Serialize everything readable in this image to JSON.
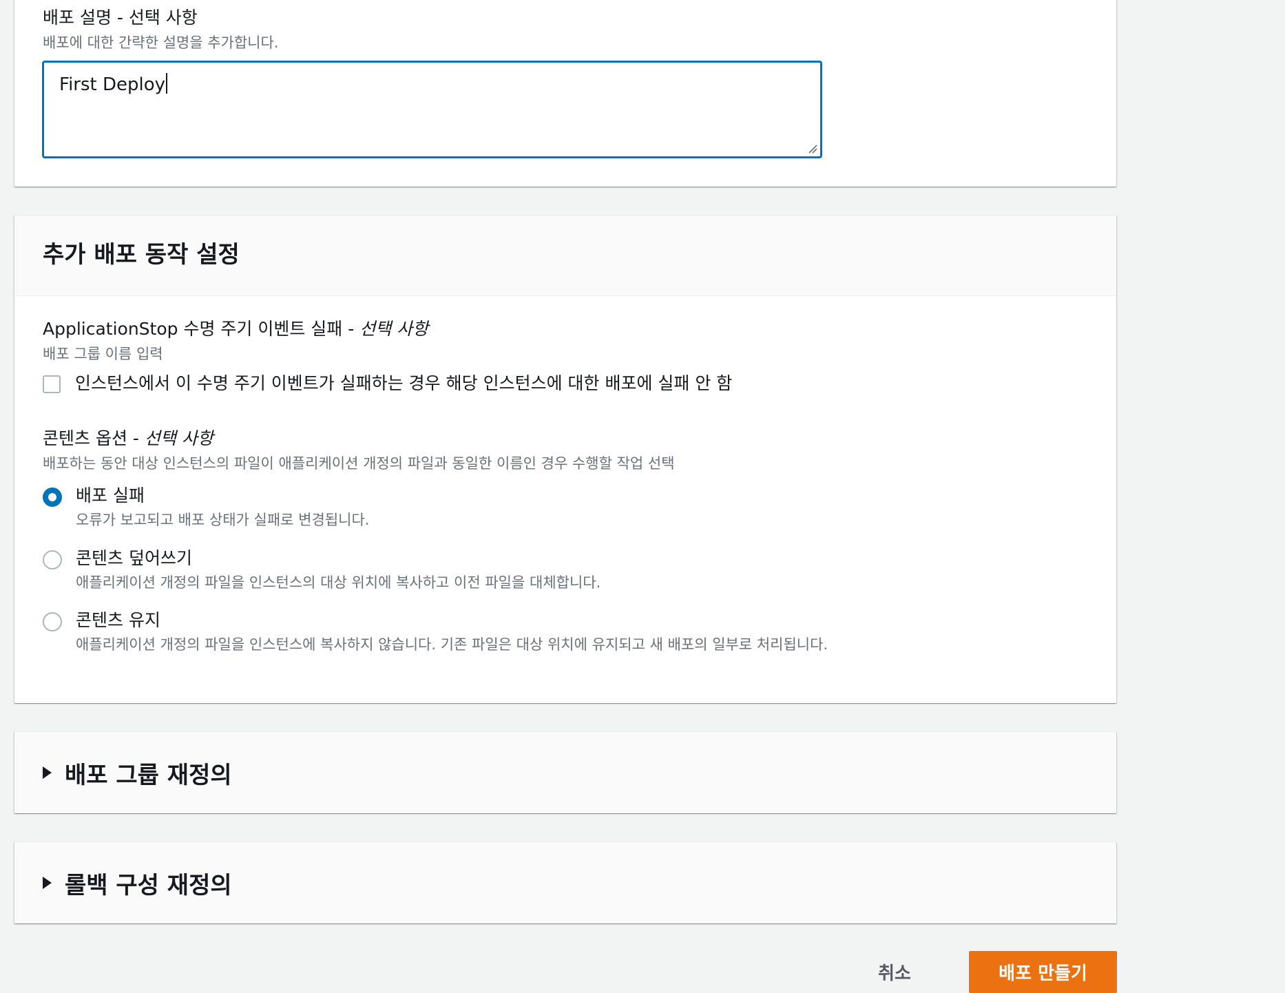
{
  "colors": {
    "accent": "#0073bb",
    "primary_button": "#ec7211",
    "page_background": "#f2f3f3",
    "secondary_text": "#687078"
  },
  "description_section": {
    "label": "배포 설명 - 선택 사항",
    "hint": "배포에 대한 간략한 설명을 추가합니다.",
    "textarea_value": "First Deploy"
  },
  "additional_settings": {
    "title": "추가 배포 동작 설정",
    "app_stop": {
      "label_main": "ApplicationStop 수명 주기 이벤트 실패 - ",
      "label_optional": "선택 사항",
      "hint": "배포 그룹 이름 입력",
      "checkbox_label": "인스턴스에서 이 수명 주기 이벤트가 실패하는 경우 해당 인스턴스에 대한 배포에 실패 안 함",
      "checkbox_checked": false
    },
    "content_options": {
      "label_main": "콘텐츠 옵션 - ",
      "label_optional": "선택 사항",
      "hint": "배포하는 동안 대상 인스턴스의 파일이 애플리케이션 개정의 파일과 동일한 이름인 경우 수행할 작업 선택",
      "selected": "fail",
      "options": [
        {
          "id": "fail",
          "label": "배포 실패",
          "description": "오류가 보고되고 배포 상태가 실패로 변경됩니다."
        },
        {
          "id": "overwrite",
          "label": "콘텐츠 덮어쓰기",
          "description": "애플리케이션 개정의 파일을 인스턴스의 대상 위치에 복사하고 이전 파일을 대체합니다."
        },
        {
          "id": "retain",
          "label": "콘텐츠 유지",
          "description": "애플리케이션 개정의 파일을 인스턴스에 복사하지 않습니다. 기존 파일은 대상 위치에 유지되고 새 배포의 일부로 처리됩니다."
        }
      ]
    }
  },
  "deployment_group_override": {
    "title": "배포 그룹 재정의",
    "icon": "caret-right-icon"
  },
  "rollback_override": {
    "title": "롤백 구성 재정의",
    "icon": "caret-right-icon"
  },
  "actions": {
    "cancel_label": "취소",
    "create_label": "배포 만들기"
  }
}
